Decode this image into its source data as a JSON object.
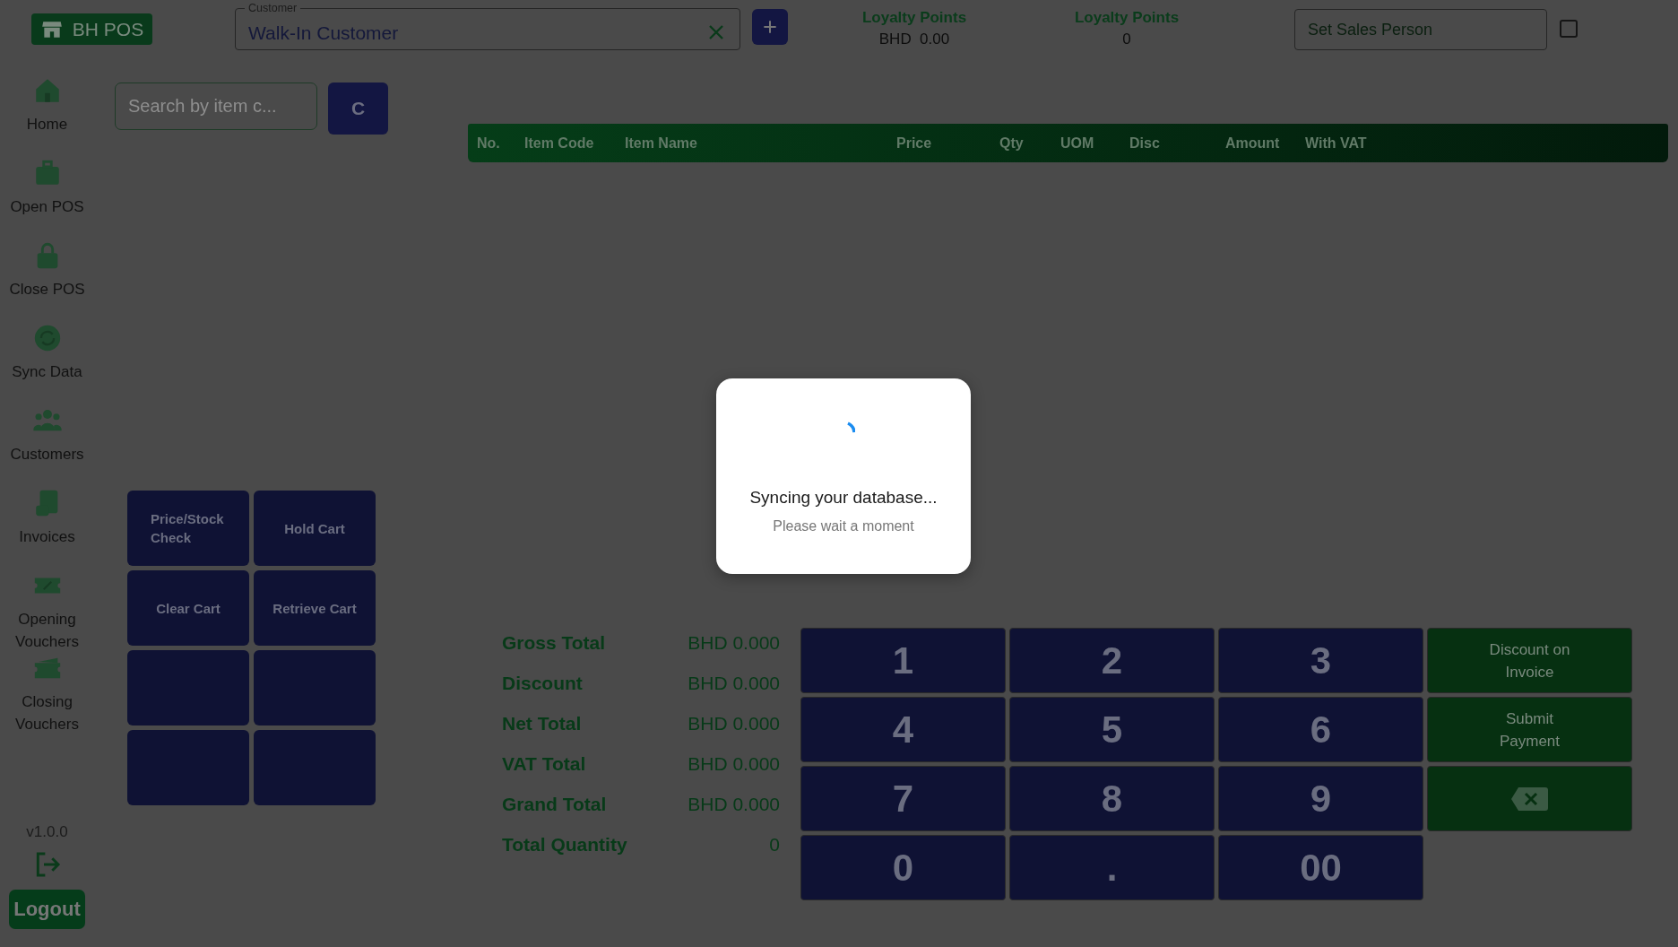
{
  "app": {
    "logo": "BH POS"
  },
  "customer_field": {
    "label": "Customer",
    "value": "Walk-In Customer"
  },
  "loyalty": [
    {
      "label": "Loyalty Points",
      "value": "BHD  0.00"
    },
    {
      "label": "Loyalty Points",
      "value": "0"
    }
  ],
  "sales_person": {
    "placeholder": "Set Sales Person",
    "checked": false
  },
  "sidebar": {
    "items": [
      {
        "label": "Home"
      },
      {
        "label": "Open POS"
      },
      {
        "label": "Close POS"
      },
      {
        "label": "Sync Data"
      },
      {
        "label": "Customers"
      },
      {
        "label": "Invoices"
      },
      {
        "label": "Opening Vouchers"
      },
      {
        "label": "Closing Vouchers"
      }
    ],
    "version": "v1.0.0",
    "logout": "Logout"
  },
  "search": {
    "placeholder": "Search by item c...",
    "button": "C"
  },
  "table": {
    "columns": [
      "No.",
      "Item Code",
      "Item Name",
      "Price",
      "Qty",
      "UOM",
      "Disc",
      "Amount",
      "With VAT"
    ]
  },
  "actions": [
    {
      "kind": "labeled",
      "label": "Price/Stock Check"
    },
    {
      "kind": "labeled",
      "label": "Hold Cart"
    },
    {
      "kind": "labeled",
      "label": "Clear Cart"
    },
    {
      "kind": "labeled",
      "label": "Retrieve Cart"
    },
    {
      "kind": "blank"
    },
    {
      "kind": "blank"
    },
    {
      "kind": "blank"
    },
    {
      "kind": "blank"
    }
  ],
  "totals": [
    {
      "label": "Gross Total",
      "value": "BHD 0.000"
    },
    {
      "label": "Discount",
      "value": "BHD 0.000"
    },
    {
      "label": "Net Total",
      "value": "BHD 0.000"
    },
    {
      "label": "VAT Total",
      "value": "BHD 0.000"
    },
    {
      "label": "Grand Total",
      "value": "BHD 0.000"
    },
    {
      "label": "Total Quantity",
      "value": "0"
    }
  ],
  "keypad": [
    {
      "kind": "digit",
      "label": "1"
    },
    {
      "kind": "digit",
      "label": "2"
    },
    {
      "kind": "digit",
      "label": "3"
    },
    {
      "kind": "action",
      "label": "Discount on Invoice"
    },
    {
      "kind": "digit",
      "label": "4"
    },
    {
      "kind": "digit",
      "label": "5"
    },
    {
      "kind": "digit",
      "label": "6"
    },
    {
      "kind": "action",
      "label": "Submit Payment"
    },
    {
      "kind": "digit",
      "label": "7"
    },
    {
      "kind": "digit",
      "label": "8"
    },
    {
      "kind": "digit",
      "label": "9"
    },
    {
      "kind": "backspace"
    },
    {
      "kind": "digit",
      "label": "0"
    },
    {
      "kind": "digit",
      "label": "."
    },
    {
      "kind": "digit",
      "label": "00"
    }
  ],
  "dialog": {
    "title": "Syncing your database...",
    "message": "Please wait a moment"
  }
}
